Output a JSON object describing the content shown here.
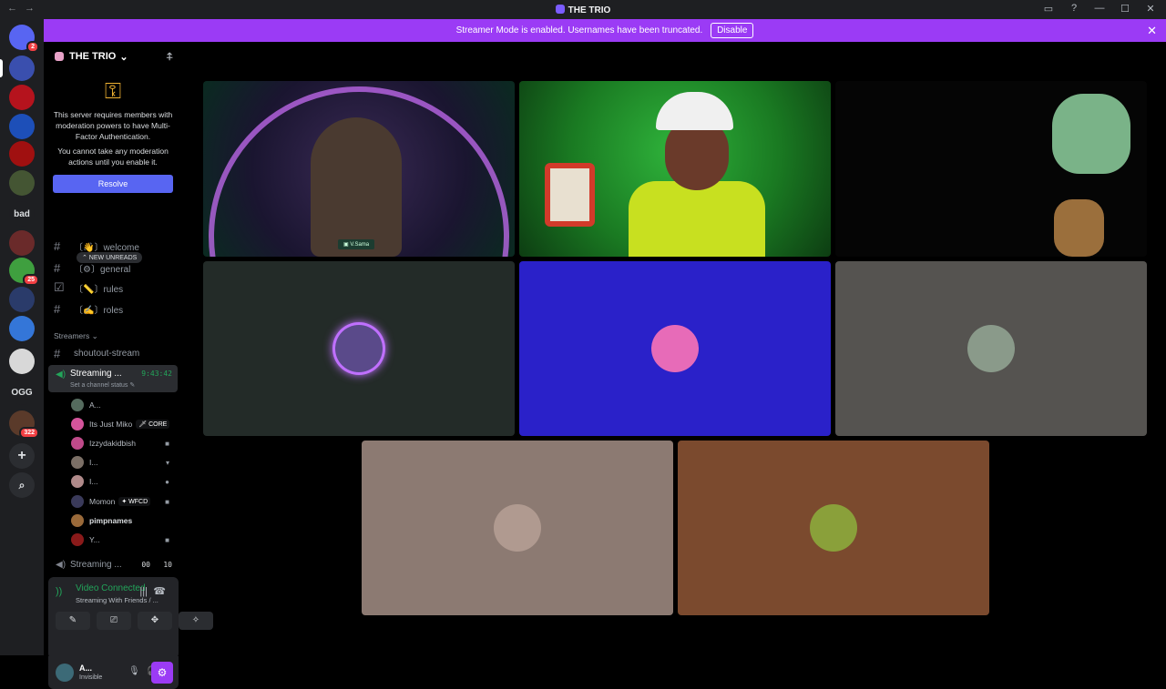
{
  "titlebar": {
    "title": "THE TRIO",
    "nav_back": "←",
    "nav_fwd": "→",
    "icons": [
      "inbox-icon",
      "help-icon",
      "minimize-icon",
      "maximize-icon",
      "close-icon"
    ],
    "glyphs": [
      "▭",
      "?",
      "—",
      "☐",
      "✕"
    ]
  },
  "rail": {
    "servers": [
      {
        "name": "discord-home",
        "badge": "2",
        "color": "#5865f2"
      },
      {
        "name": "server-1",
        "color": "#3a4fae"
      },
      {
        "name": "server-2",
        "color": "#b5131d"
      },
      {
        "name": "server-3",
        "color": "#1d4fb8"
      },
      {
        "name": "server-4",
        "color": "#a01010"
      },
      {
        "name": "server-5",
        "color": "#445533"
      },
      {
        "name": "server-bad",
        "text": "bad",
        "color": "#1e1f22"
      },
      {
        "name": "server-7",
        "color": "#6a2a2a"
      },
      {
        "name": "server-8",
        "badge": "25",
        "color": "#3f9f3f"
      },
      {
        "name": "server-9",
        "color": "#2a3b6a"
      },
      {
        "name": "server-10",
        "color": "#3476d8"
      },
      {
        "name": "server-11",
        "color": "#d8d8d8"
      },
      {
        "name": "server-ogg",
        "text": "OGG",
        "color": "#1e1f22"
      },
      {
        "name": "server-13",
        "badge": "322",
        "color": "#5a3a2a"
      }
    ],
    "add_glyph": "+",
    "discover_glyph": "⌕"
  },
  "banner": {
    "text": "Streamer Mode is enabled. Usernames have been truncated.",
    "button": "Disable",
    "close": "✕"
  },
  "sidebar": {
    "server_name": "THE TRIO",
    "chevron": "⌄",
    "add_member": "⍏",
    "mfa": {
      "key_glyph": "⚿",
      "line1": "This server requires members with moderation powers to have Multi-Factor Authentication.",
      "line2": "You cannot take any moderation actions until you enable it.",
      "resolve": "Resolve"
    },
    "new_unreads": "⌃ NEW UNREADS",
    "channels": [
      {
        "icon": "#",
        "name": "〔👋〕welcome"
      },
      {
        "icon": "#",
        "name": "〔⚙〕general"
      },
      {
        "icon": "☑",
        "name": "〔📏〕rules"
      },
      {
        "icon": "#",
        "name": "〔✍〕roles"
      }
    ],
    "category": "Streamers ⌄",
    "shoutout": "shoutout-stream",
    "active_voice": {
      "name": "Streaming ...",
      "time": "9:43:42",
      "status": "Set a channel status ✎"
    },
    "members": [
      {
        "name": "A...",
        "color": "#556b5e",
        "tag": "",
        "cam": ""
      },
      {
        "name": "Its Just Miko",
        "color": "#d4549b",
        "tag": "🗡 CORE",
        "cam": ""
      },
      {
        "name": "Izzydakidbish",
        "color": "#c04a8a",
        "tag": "",
        "cam": "■"
      },
      {
        "name": "I...",
        "color": "#7b6f66",
        "tag": "",
        "cam": "▾"
      },
      {
        "name": "I...",
        "color": "#b08a8a",
        "tag": "",
        "cam": "●"
      },
      {
        "name": "Momon",
        "color": "#3a3a5a",
        "tag": "✦ WFCD",
        "cam": "■"
      },
      {
        "name": "pimpnames",
        "color": "#9a6a3a",
        "tag": "",
        "cam": ""
      },
      {
        "name": "Y...",
        "color": "#8a1a1a",
        "tag": "",
        "cam": "■"
      }
    ],
    "other_voice": {
      "name": "Streaming ...",
      "count1": "00",
      "count2": "10"
    }
  },
  "voice_panel": {
    "title": "Video Connected",
    "subtitle": "Streaming With Friends / ...",
    "buttons": [
      "✎",
      "⎚",
      "✥",
      "✧"
    ],
    "noise_glyph": "|||",
    "disconnect_glyph": "☎"
  },
  "user": {
    "name": "A...",
    "status": "Invisible",
    "mic": "🎙",
    "headset": "🎧",
    "gear": "⚙"
  },
  "stage": {
    "cam_label": "▣ V.Sama",
    "tiles": [
      {
        "name": "video-tile-1",
        "bg": "#1a1530"
      },
      {
        "name": "video-tile-2",
        "bg": "#1f8a2a"
      },
      {
        "name": "video-tile-3",
        "bg": "#050505"
      },
      {
        "name": "tile-4",
        "bg": "#232b28",
        "avatar": "#5a4a8a"
      },
      {
        "name": "tile-5",
        "bg": "#2a21c9",
        "avatar": "#e76bb8"
      },
      {
        "name": "tile-6",
        "bg": "#555350",
        "avatar": "#8a9a8a"
      },
      {
        "name": "tile-7",
        "bg": "#8c7a72",
        "avatar": "#b09a90"
      },
      {
        "name": "tile-8",
        "bg": "#7b4a2e",
        "avatar": "#8aa03a"
      }
    ]
  }
}
